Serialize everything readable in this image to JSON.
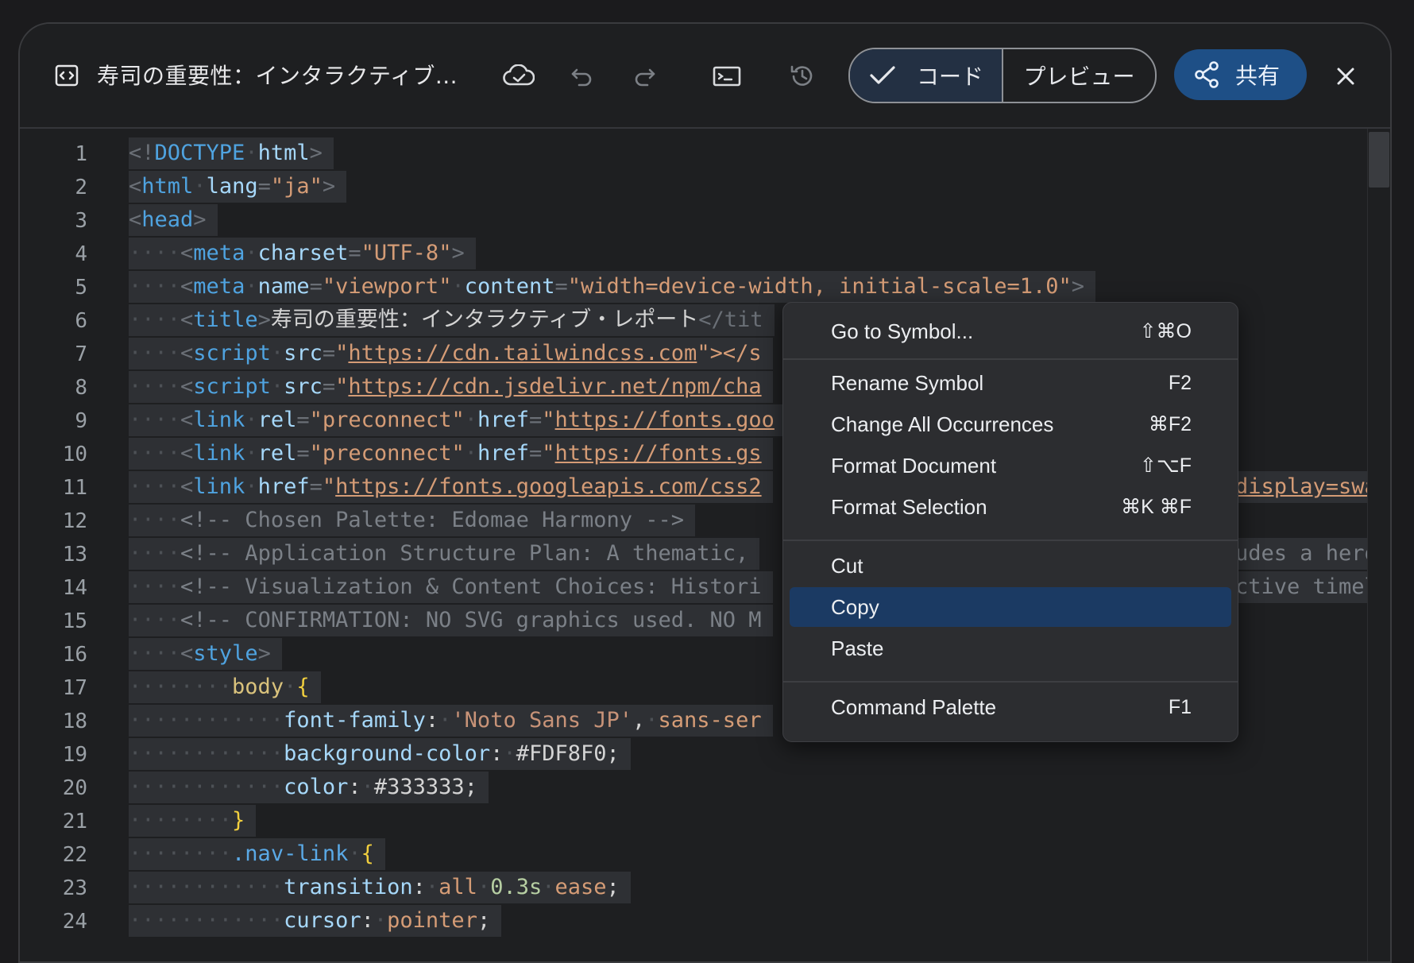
{
  "header": {
    "title": "寿司の重要性：インタラクティブ...",
    "mode_code": "コード",
    "mode_preview": "プレビュー",
    "share_label": "共有",
    "accent_color": "#1e4f86"
  },
  "toolbar_icons": [
    "code-file-icon",
    "cloud-sync-icon",
    "undo-icon",
    "redo-icon",
    "terminal-icon",
    "history-icon",
    "check-icon",
    "share-icon",
    "close-icon"
  ],
  "editor": {
    "line_numbers": [
      "1",
      "2",
      "3",
      "4",
      "5",
      "6",
      "7",
      "8",
      "9",
      "10",
      "11",
      "12",
      "13",
      "14",
      "15",
      "16",
      "17",
      "18",
      "19",
      "20",
      "21",
      "22",
      "23",
      "24"
    ],
    "lines": {
      "l1_doctype": "DOCTYPE",
      "l1_html": "html",
      "l2_html": "html",
      "l2_lang": "lang",
      "l2_ja": "\"ja\"",
      "l3_head": "head",
      "l4_meta": "meta",
      "l4_charset": "charset",
      "l4_val": "\"UTF-8\"",
      "l5_meta": "meta",
      "l5_name": "name",
      "l5_nameval": "\"viewport\"",
      "l5_content": "content",
      "l5_contentval": "\"width=device-width, initial-scale=1.0\"",
      "l6_title": "title",
      "l6_text": "寿司の重要性：インタラクティブ・レポート",
      "l6_close": "</tit",
      "l7_script": "script",
      "l7_src": "src",
      "l7_url": "https://cdn.tailwindcss.com",
      "l7_tail": "\"></s",
      "l8_script": "script",
      "l8_src": "src",
      "l8_url": "https://cdn.jsdelivr.net/npm/cha",
      "l9_link": "link",
      "l9_rel": "rel",
      "l9_relval": "\"preconnect\"",
      "l9_href": "href",
      "l9_url": "https://fonts.goo",
      "l10_link": "link",
      "l10_rel": "rel",
      "l10_relval": "\"preconnect\"",
      "l10_href": "href",
      "l10_url": "https://fonts.gs",
      "l11_link": "link",
      "l11_href": "href",
      "l11_url": "https://fonts.googleapis.com/css2",
      "l11_tail": "display=swap",
      "l12_comment": "<!-- Chosen Palette: Edomae Harmony -->",
      "l13_comment": "<!-- Application Structure Plan: A thematic,",
      "l13_tail": "udes a hero",
      "l14_comment": "<!-- Visualization & Content Choices: Histori",
      "l14_tail": "ctive timeli",
      "l15_comment": "<!-- CONFIRMATION: NO SVG graphics used. NO M",
      "l16_style": "style",
      "l17_sel": "body",
      "l18_prop": "font-family",
      "l18_val1": "'Noto Sans JP'",
      "l18_val2": "sans-ser",
      "l19_prop": "background-color",
      "l19_val": "#FDF8F0",
      "l20_prop": "color",
      "l20_val": "#333333",
      "l22_sel": ".nav-link",
      "l23_prop": "transition",
      "l23_v1": "all",
      "l23_v2": "0.3s",
      "l23_v3": "ease",
      "l24_prop": "cursor",
      "l24_val": "pointer"
    }
  },
  "context_menu": {
    "items": [
      {
        "label": "Go to Symbol...",
        "shortcut": "⇧⌘O"
      },
      {
        "label": "Rename Symbol",
        "shortcut": "F2"
      },
      {
        "label": "Change All Occurrences",
        "shortcut": "⌘F2"
      },
      {
        "label": "Format Document",
        "shortcut": "⇧⌥F"
      },
      {
        "label": "Format Selection",
        "shortcut": "⌘K ⌘F"
      },
      {
        "label": "Cut",
        "shortcut": ""
      },
      {
        "label": "Copy",
        "shortcut": ""
      },
      {
        "label": "Paste",
        "shortcut": ""
      },
      {
        "label": "Command Palette",
        "shortcut": "F1"
      }
    ],
    "active_item": "Copy",
    "active_color": "#1b3a63"
  }
}
